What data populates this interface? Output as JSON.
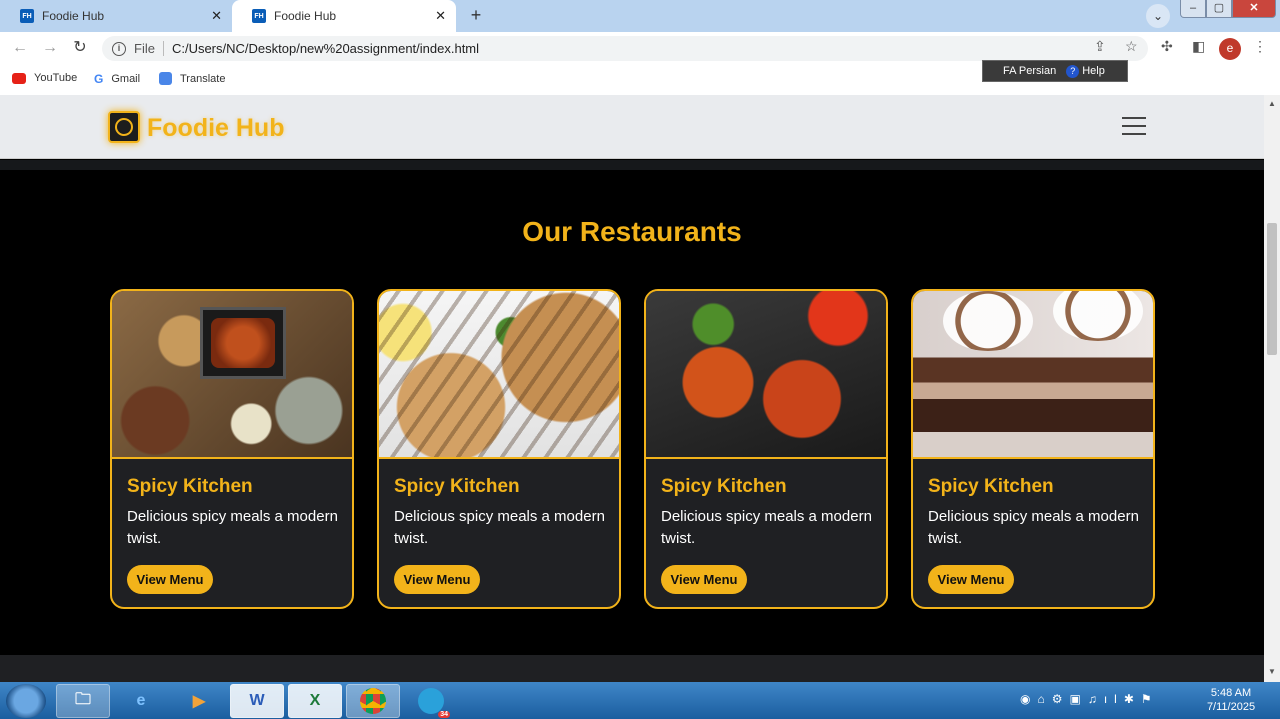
{
  "browser": {
    "tabs": [
      {
        "favicon": "FH",
        "title": "Foodie Hub"
      },
      {
        "favicon": "FH",
        "title": "Foodie Hub"
      }
    ],
    "address_prefix": "File",
    "url": "C:/Users/NC/Desktop/new%20assignment/index.html",
    "profile_initial": "e",
    "bookmarks": [
      "YouTube",
      "Gmail",
      "Translate"
    ],
    "language_bar": {
      "language": "FA Persian",
      "help": "Help"
    }
  },
  "site": {
    "brand": "Foodie Hub",
    "section_title": "Our Restaurants",
    "cards": [
      {
        "image": "platter-image",
        "name": "Spicy Kitchen",
        "description": "Delicious spicy meals a modern twist.",
        "button": "View Menu"
      },
      {
        "image": "grilled-chicken-image",
        "name": "Spicy Kitchen",
        "description": "Delicious spicy meals a modern twist.",
        "button": "View Menu"
      },
      {
        "image": "chicken-wings-image",
        "name": "Spicy Kitchen",
        "description": "Delicious spicy meals a modern twist.",
        "button": "View Menu"
      },
      {
        "image": "dessert-image",
        "name": "Spicy Kitchen",
        "description": "Delicious spicy meals a modern twist.",
        "button": "View Menu"
      }
    ]
  },
  "taskbar": {
    "apps": [
      "explorer-icon",
      "internet-explorer-icon",
      "media-player-icon",
      "word-icon",
      "excel-icon",
      "chrome-icon",
      "telegram-icon"
    ],
    "word_label": "W",
    "excel_label": "X",
    "telegram_badge": "34",
    "time": "5:48 AM",
    "date": "7/11/2025"
  },
  "colors": {
    "accent": "#f2b31a",
    "card_bg": "#1f2023",
    "page_bg": "#000000",
    "navbar_bg": "#e9ebee"
  }
}
